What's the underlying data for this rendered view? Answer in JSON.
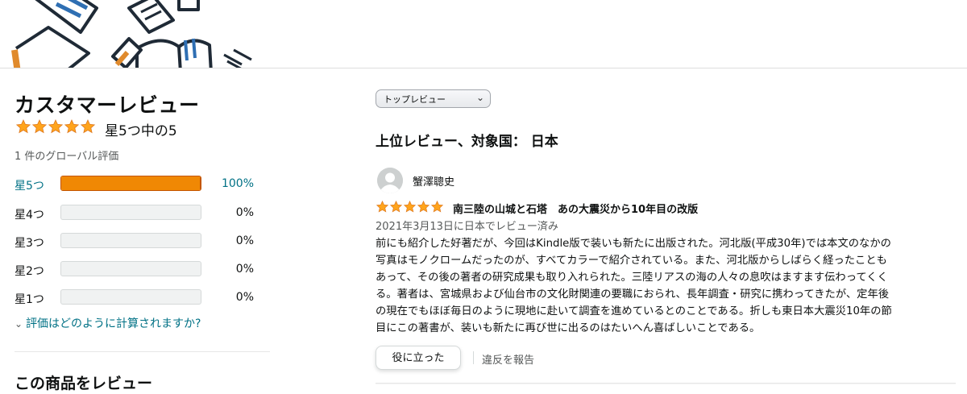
{
  "customer_reviews": {
    "title": "カスタマーレビュー",
    "stars": 5,
    "stars_text": "星5つ中の5",
    "global_ratings": "1 件のグローバル評価",
    "histogram": [
      {
        "label": "星5つ",
        "percent": 100,
        "percent_text": "100%"
      },
      {
        "label": "星4つ",
        "percent": 0,
        "percent_text": "0%"
      },
      {
        "label": "星3つ",
        "percent": 0,
        "percent_text": "0%"
      },
      {
        "label": "星2つ",
        "percent": 0,
        "percent_text": "0%"
      },
      {
        "label": "星1つ",
        "percent": 0,
        "percent_text": "0%"
      }
    ],
    "how_calculated": "評価はどのように計算されますか?",
    "review_this_product": "この商品をレビュー"
  },
  "sort": {
    "selected": "トップレビュー"
  },
  "top_reviews_heading": "上位レビュー、対象国： 日本",
  "review": {
    "reviewer": "蟹澤聰史",
    "stars": 5,
    "title": "南三陸の山城と石塔　あの大震災から10年目の改版",
    "date": "2021年3月13日に日本でレビュー済み",
    "body_lines": [
      "前にも紹介した好著だが、今回はKindle版で装いも新たに出版された。河北版(平成30年)では本文のなかの",
      "写真はモノクロームだったのが、すべてカラーで紹介されている。また、河北版からしばらく経ったことも",
      "あって、その後の著者の研究成果も取り入れられた。三陸リアスの海の人々の息吹はますます伝わってくく",
      "る。著者は、宮城県および仙台市の文化財関連の要職におられ、長年調査・研究に携わってきたが、定年後",
      "の現在でもほぼ毎日のように現地に赴いて調査を進めているとのことである。折しも東日本大震災10年の節",
      "目にこの著書が、装いも新たに再び世に出るのはたいへん喜ばしいことである。"
    ],
    "helpful_label": "役に立った",
    "report_label": "違反を報告"
  },
  "colors": {
    "star": "#ffa41c",
    "bar_fill": "#f08804",
    "link": "#007185"
  }
}
